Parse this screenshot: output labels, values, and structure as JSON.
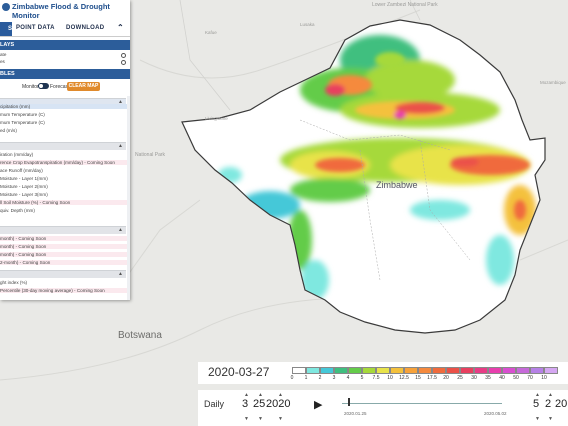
{
  "panel": {
    "title": "Zimbabwe Flood & Drought Monitor",
    "nav_tabs": [
      "S",
      "POINT DATA",
      "DOWNLOAD"
    ],
    "collapse_icon": "double-chevron-up-icon",
    "sections": {
      "overlays": "LAYS",
      "variables": "BLES"
    },
    "overlay_rows": [
      "ate",
      "es"
    ],
    "toggle": {
      "left": "Monitor",
      "right": "Forecast"
    },
    "clear_button": "CLEAR MAP",
    "rows_a": [
      "cipitation (mm)",
      "mum Temperature (C)",
      "mum Temperature (C)",
      "ed (m/s)"
    ],
    "rows_b": [
      {
        "text": "iration (mm/day)",
        "pink": false
      },
      {
        "text": "rence Crop Evapotranspiration (mm/day) - Coming Soon",
        "pink": true
      },
      {
        "text": "ace Runoff (mm/day)",
        "pink": false
      },
      {
        "text": "Moisture - Layer 1(mm)",
        "pink": false
      },
      {
        "text": "Moisture - Layer 2(mm)",
        "pink": false
      },
      {
        "text": "Moisture - Layer 3(mm)",
        "pink": false
      },
      {
        "text": "ll Soil Moisture (%) - Coming Soon",
        "pink": true
      },
      {
        "text": "quiv. Depth (mm)",
        "pink": false
      }
    ],
    "rows_c": [
      {
        "text": "month) - Coming Soon",
        "pink": true
      },
      {
        "text": "month) - Coming Soon",
        "pink": true
      },
      {
        "text": "month) - Coming Soon",
        "pink": true
      },
      {
        "text": "2-month) - Coming Soon",
        "pink": true
      }
    ],
    "rows_d": [
      {
        "text": "ght index (%)",
        "pink": false
      },
      {
        "text": "Percentile (30-day moving average) - Coming Soon",
        "pink": true
      }
    ]
  },
  "map_labels": {
    "country": "Zimbabwe",
    "botswana": "Botswana",
    "lower_zambezi": "Lower Zambezi National Park",
    "national_park": "National Park",
    "small": [
      "Kafue",
      "Livingstone",
      "Mozambique",
      "Lusaka"
    ]
  },
  "legend": {
    "date": "2020-03-27",
    "values": [
      "0",
      "1",
      "2",
      "3",
      "4",
      "5",
      "7.5",
      "10",
      "12.5",
      "15",
      "17.5",
      "20",
      "25",
      "30",
      "35",
      "40",
      "50",
      "70",
      "10"
    ],
    "colors": [
      "#ffffff",
      "#7fe8e0",
      "#45c8d8",
      "#3fbf7f",
      "#64cc4a",
      "#a6d93a",
      "#e8e34a",
      "#f4c13c",
      "#f7a23a",
      "#f58a3e",
      "#f06b3d",
      "#eb5148",
      "#e8405f",
      "#e83c86",
      "#e83fae",
      "#d94fd0",
      "#c66ad9",
      "#b681e6",
      "#d5a7f2"
    ]
  },
  "timeline": {
    "mode": "Daily",
    "start_month": "3",
    "start_day": "25",
    "start_year": "2020",
    "end_month": "5",
    "end_day": "2",
    "end_year": "20",
    "track_start_label": "2020.01.25",
    "track_end_label": "2020.05.02",
    "play_icon": "play-icon"
  }
}
